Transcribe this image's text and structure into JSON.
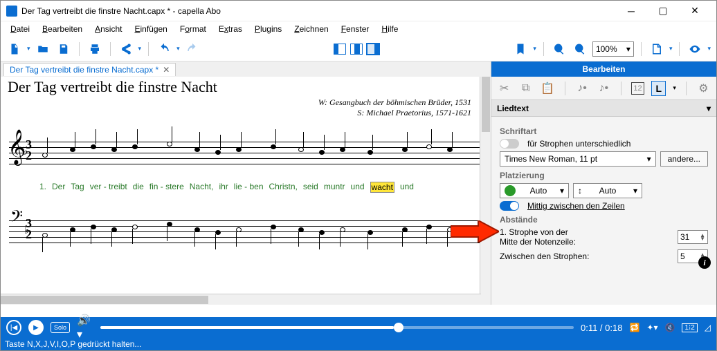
{
  "window": {
    "title": "Der Tag vertreibt die finstre Nacht.capx * - capella Abo"
  },
  "menu": {
    "file": "Datei",
    "edit": "Bearbeiten",
    "view": "Ansicht",
    "insert": "Einfügen",
    "format": "Format",
    "extras": "Extras",
    "plugins": "Plugins",
    "draw": "Zeichnen",
    "window": "Fenster",
    "help": "Hilfe"
  },
  "toolbar": {
    "zoom": "100%"
  },
  "tab": {
    "name": "Der Tag vertreibt die finstre Nacht.capx *"
  },
  "score": {
    "title": "Der Tag vertreibt die finstre Nacht",
    "credit1": "W: Gesangbuch der böhmischen Brüder, 1531",
    "credit2": "S: Michael Praetorius, 1571-1621",
    "lyrics": {
      "num": "1.",
      "w": [
        "Der",
        "Tag",
        "ver - treibt",
        "die",
        "fin  -  stere",
        "Nacht,",
        "ihr",
        "lie - ben",
        "Christn,",
        "seid",
        "muntr",
        "und"
      ],
      "hl": "wacht",
      "tail": "und"
    }
  },
  "side": {
    "title": "Bearbeiten",
    "section": "Liedtext",
    "font_label": "Schriftart",
    "font_toggle": "für Strophen unterschiedlich",
    "font_value": "Times New Roman, 11 pt",
    "font_other": "andere...",
    "place_label": "Platzierung",
    "place_auto": "Auto",
    "place_mid": "Mittig zwischen den Zeilen",
    "dist_label": "Abstände",
    "dist1a": "1. Strophe von der",
    "dist1b": "Mitte der Notenzeile:",
    "dist1v": "31",
    "dist2": "Zwischen den Strophen:",
    "dist2v": "5",
    "boxnum": "12",
    "L": "L"
  },
  "player": {
    "solo": "Solo",
    "time": "0:11 / 0:18"
  },
  "status": {
    "text": "Taste N,X,J,V,I,O,P gedrückt halten..."
  }
}
